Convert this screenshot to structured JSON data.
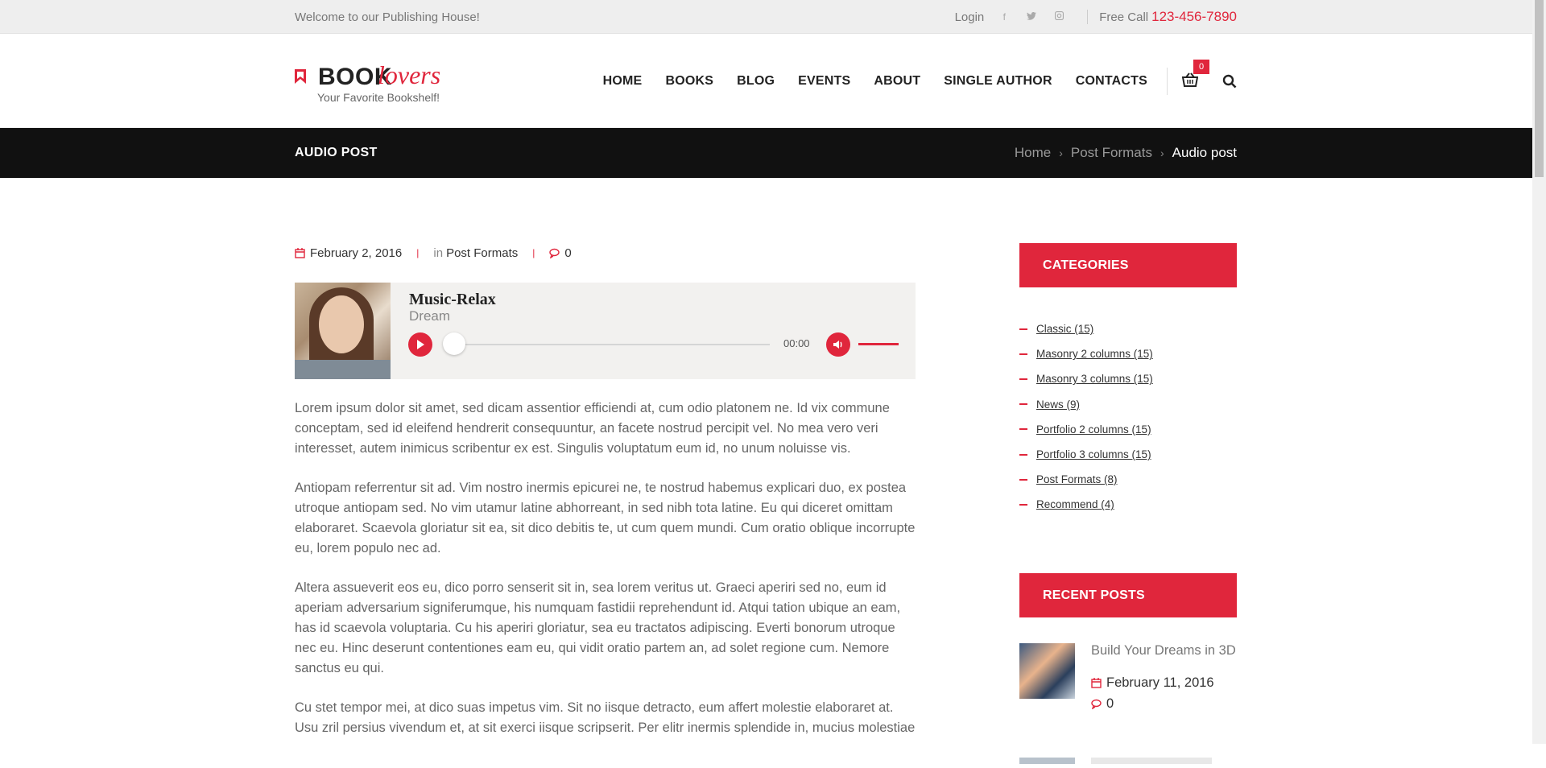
{
  "topbar": {
    "welcome": "Welcome to our Publishing House!",
    "login": "Login",
    "social": [
      "facebook-icon",
      "twitter-icon",
      "instagram-icon"
    ],
    "freecall_label": "Free Call",
    "phone": "123-456-7890"
  },
  "logo": {
    "part1": "BOOK",
    "part2": "lovers",
    "tagline": "Your Favorite Bookshelf!"
  },
  "nav": {
    "items": [
      "HOME",
      "BOOKS",
      "BLOG",
      "EVENTS",
      "ABOUT",
      "SINGLE AUTHOR",
      "CONTACTS"
    ],
    "cart_count": "0"
  },
  "titlebar": {
    "title": "AUDIO POST",
    "breadcrumbs": [
      "Home",
      "Post Formats",
      "Audio post"
    ]
  },
  "post": {
    "date": "February 2, 2016",
    "in_label": "in",
    "category": "Post Formats",
    "comments": "0",
    "player": {
      "title": "Music-Relax",
      "artist": "Dream",
      "time": "00:00",
      "progress": 0,
      "volume": 1.0
    },
    "paragraphs": [
      "Lorem ipsum dolor sit amet, sed dicam assentior efficiendi at, cum odio platonem ne. Id vix commune conceptam, sed id eleifend hendrerit consequuntur, an facete nostrud percipit vel. No mea vero veri interesset, autem inimicus scribentur ex est. Singulis voluptatum eum id, no unum noluisse vis.",
      "Antiopam referrentur sit ad. Vim nostro inermis epicurei ne, te nostrud habemus explicari duo, ex postea utroque antiopam sed. No vim utamur latine abhorreant, in sed nibh tota latine. Eu qui diceret omittam elaboraret. Scaevola gloriatur sit ea, sit dico debitis te, ut cum quem mundi. Cum oratio oblique incorrupte eu, lorem populo nec ad.",
      "Altera assueverit eos eu, dico porro senserit sit in, sea lorem veritus ut. Graeci aperiri sed no, eum id aperiam adversarium signiferumque, his numquam fastidii reprehendunt id. Atqui tation ubique an eam, has id scaevola voluptaria. Cu his aperiri gloriatur, sea eu tractatos adipiscing. Everti bonorum utroque nec eu. Hinc deserunt contentiones eam eu, qui vidit oratio partem an, ad solet regione cum. Nemore sanctus eu qui.",
      "Cu stet tempor mei, at dico suas impetus vim. Sit no iisque detracto, eum affert molestie elaboraret at. Usu zril persius vivendum et, at sit exerci iisque scripserit. Per elitr inermis splendide in, mucius molestiae"
    ]
  },
  "sidebar": {
    "categories_title": "CATEGORIES",
    "categories": [
      "Classic (15)",
      "Masonry 2 columns (15)",
      "Masonry 3 columns (15)",
      "News (9)",
      "Portfolio 2 columns (15)",
      "Portfolio 3 columns (15)",
      "Post Formats (8)",
      "Recommend (4)"
    ],
    "recent_title": "RECENT POSTS",
    "recent": [
      {
        "title": "Build Your Dreams in 3D",
        "date": "February 11, 2016",
        "comments": "0"
      }
    ]
  },
  "colors": {
    "accent": "#e0263c",
    "dark": "#111111",
    "topbar": "#eeeeee"
  }
}
